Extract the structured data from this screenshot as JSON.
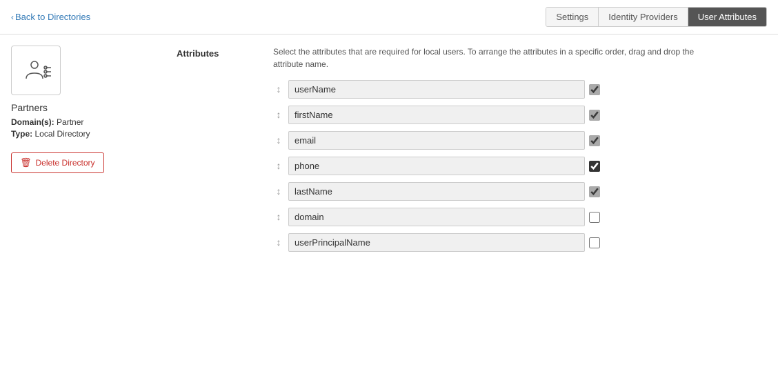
{
  "header": {
    "back_label": "Back to Directories",
    "tabs": [
      {
        "id": "settings",
        "label": "Settings",
        "active": false
      },
      {
        "id": "identity-providers",
        "label": "Identity Providers",
        "active": false
      },
      {
        "id": "user-attributes",
        "label": "User Attributes",
        "active": true
      }
    ]
  },
  "sidebar": {
    "directory_name": "Partners",
    "domain_label": "Domain(s):",
    "domain_value": "Partner",
    "type_label": "Type:",
    "type_value": "Local Directory",
    "delete_label": "Delete Directory"
  },
  "content": {
    "section_label": "Attributes",
    "description": "Select the attributes that are required for local users. To arrange the attributes in a specific order, drag and drop the attribute name.",
    "attributes": [
      {
        "name": "userName",
        "checked": true,
        "checked_style": "light"
      },
      {
        "name": "firstName",
        "checked": true,
        "checked_style": "light"
      },
      {
        "name": "email",
        "checked": true,
        "checked_style": "light"
      },
      {
        "name": "phone",
        "checked": true,
        "checked_style": "dark"
      },
      {
        "name": "lastName",
        "checked": true,
        "checked_style": "light"
      },
      {
        "name": "domain",
        "checked": false,
        "checked_style": ""
      },
      {
        "name": "userPrincipalName",
        "checked": false,
        "checked_style": ""
      }
    ]
  }
}
